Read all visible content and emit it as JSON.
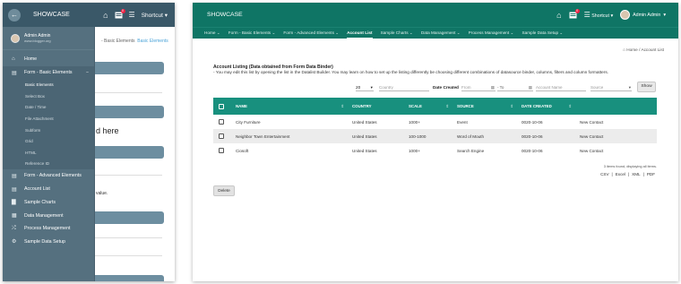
{
  "mobile": {
    "title": "SHOWCASE",
    "shortcut_label": "Shortcut",
    "notif_count": "0",
    "user": {
      "name": "Admin Admin",
      "email": "www.blogger.org"
    },
    "breadcrumb": {
      "prefix": "- Basic Elements",
      "current": "Basic Elements"
    },
    "bg_text": {
      "here": "d here",
      "value": "value."
    },
    "nav": [
      {
        "label": "Home",
        "icon": "home-icon"
      },
      {
        "label": "Form - Basic Elements",
        "icon": "form-icon",
        "open": true
      },
      {
        "label": "Form - Advanced Elements",
        "icon": "form-icon"
      },
      {
        "label": "Account List",
        "icon": "list-icon"
      },
      {
        "label": "Sample Charts",
        "icon": "chart-icon"
      },
      {
        "label": "Data Management",
        "icon": "grid-icon"
      },
      {
        "label": "Process Management",
        "icon": "shuffle-icon"
      },
      {
        "label": "Sample Data Setup",
        "icon": "gears-icon"
      }
    ],
    "subnav": [
      "Basic Elements",
      "Select Box",
      "Date / Time",
      "File Attachment",
      "Subform",
      "Grid",
      "HTML",
      "Reference ID"
    ]
  },
  "desktop": {
    "title": "SHOWCASE",
    "shortcut_label": "Shortcut",
    "notif_count": "0",
    "user_label": "Admin Admin",
    "menu": [
      "Home",
      "Form - Basic Elements",
      "Form - Advanced Elements",
      "Account List",
      "Sample Charts",
      "Data Management",
      "Process Management",
      "Sample Data Setup"
    ],
    "active_menu": "Account List",
    "breadcrumb": {
      "home": "Home",
      "sep": "/",
      "current": "Account List"
    },
    "list_title": "Account Listing (Data obtained from Form Data Binder)",
    "list_desc": "- You may edit this list by opening the list in the Datalist Builder. You may learn on how to set up the listing differently be choosing different combinations of datasource binder, columns, filters and column formatters.",
    "filters": {
      "page_size": "20",
      "country_placeholder": "Country",
      "date_created_label": "Date Created",
      "from_placeholder": "From",
      "to_label": "- To",
      "account_name_placeholder": "Account Name",
      "source_placeholder": "Source",
      "show_button": "Show"
    },
    "table": {
      "columns": [
        "NAME",
        "COUNTRY",
        "SCALE",
        "SOURCE",
        "DATE CREATED"
      ],
      "rows": [
        {
          "name": "City Furniture",
          "country": "United States",
          "scale": "1000+",
          "source": "Event",
          "date": "0020-10-06",
          "action": "New Contact"
        },
        {
          "name": "Neighbor Town Entertainment",
          "country": "United States",
          "scale": "100-1000",
          "source": "Word of Mouth",
          "date": "0020-10-06",
          "action": "New Contact"
        },
        {
          "name": "Ciosoft",
          "country": "United States",
          "scale": "1000+",
          "source": "Search Engine",
          "date": "0020-10-06",
          "action": "New Contact"
        }
      ]
    },
    "found_text": "3 items found, displaying all items.",
    "exports": [
      "CSV",
      "Excel",
      "XML",
      "PDF"
    ],
    "delete_button": "Delete",
    "colors": {
      "header": "#0f7565",
      "table_header": "#18907e",
      "drawer": "#55707f"
    }
  }
}
